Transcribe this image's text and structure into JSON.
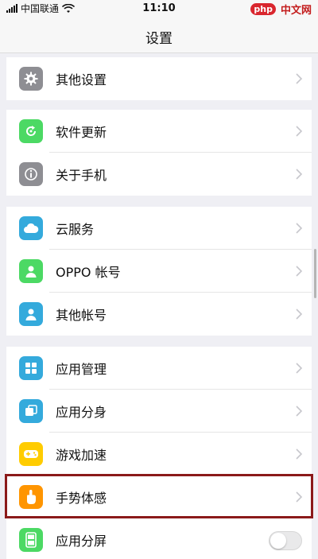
{
  "status_bar": {
    "carrier": "中国联通",
    "time": "11:10",
    "badge_php": "php",
    "badge_cn": "中文网"
  },
  "nav": {
    "title": "设置"
  },
  "groups": [
    {
      "items": [
        {
          "label": "其他设置",
          "icon": "gear-icon",
          "color": "#8e8e93"
        }
      ]
    },
    {
      "items": [
        {
          "label": "软件更新",
          "icon": "refresh-icon",
          "color": "#4cd964"
        },
        {
          "label": "关于手机",
          "icon": "info-icon",
          "color": "#8e8e93"
        }
      ]
    },
    {
      "items": [
        {
          "label": "云服务",
          "icon": "cloud-icon",
          "color": "#34aadc"
        },
        {
          "label": "OPPO 帐号",
          "icon": "user-icon",
          "color": "#4cd964"
        },
        {
          "label": "其他帐号",
          "icon": "user-icon",
          "color": "#34aadc"
        }
      ]
    },
    {
      "items": [
        {
          "label": "应用管理",
          "icon": "grid-icon",
          "color": "#34aadc"
        },
        {
          "label": "应用分身",
          "icon": "clone-icon",
          "color": "#34aadc"
        },
        {
          "label": "游戏加速",
          "icon": "gamepad-icon",
          "color": "#ffcc00"
        },
        {
          "label": "手势体感",
          "icon": "hand-icon",
          "color": "#ff9500"
        },
        {
          "label": "应用分屏",
          "icon": "split-screen-icon",
          "color": "#4cd964",
          "toggle": false
        }
      ]
    }
  ]
}
